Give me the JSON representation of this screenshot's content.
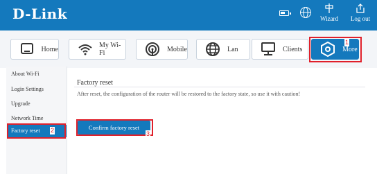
{
  "header": {
    "logo": "D-Link",
    "wizard_label": "Wizard",
    "logout_label": "Log out"
  },
  "tabs": [
    {
      "label": "Home",
      "icon": "monitor-icon"
    },
    {
      "label": "My Wi-Fi",
      "icon": "wifi-icon"
    },
    {
      "label": "Mobile",
      "icon": "mobile-signal-icon"
    },
    {
      "label": "Lan",
      "icon": "globe-icon"
    },
    {
      "label": "Clients",
      "icon": "clients-icon"
    },
    {
      "label": "More",
      "icon": "hexagon-settings-icon",
      "active": true
    }
  ],
  "sidebar": {
    "items": [
      {
        "label": "About Wi-Fi"
      },
      {
        "label": "Login Settings"
      },
      {
        "label": "Upgrade"
      },
      {
        "label": "Network Time"
      },
      {
        "label": "Factory reset",
        "active": true
      }
    ]
  },
  "main": {
    "title": "Factory reset",
    "description": "After reset, the configuration of the router will be restored to the factory state, so use it with caution!",
    "confirm_label": "Confirm factory reset"
  },
  "annotations": [
    "1",
    "2",
    "3"
  ],
  "colors": {
    "brand": "#1479bd",
    "annotation": "#e0202a"
  }
}
